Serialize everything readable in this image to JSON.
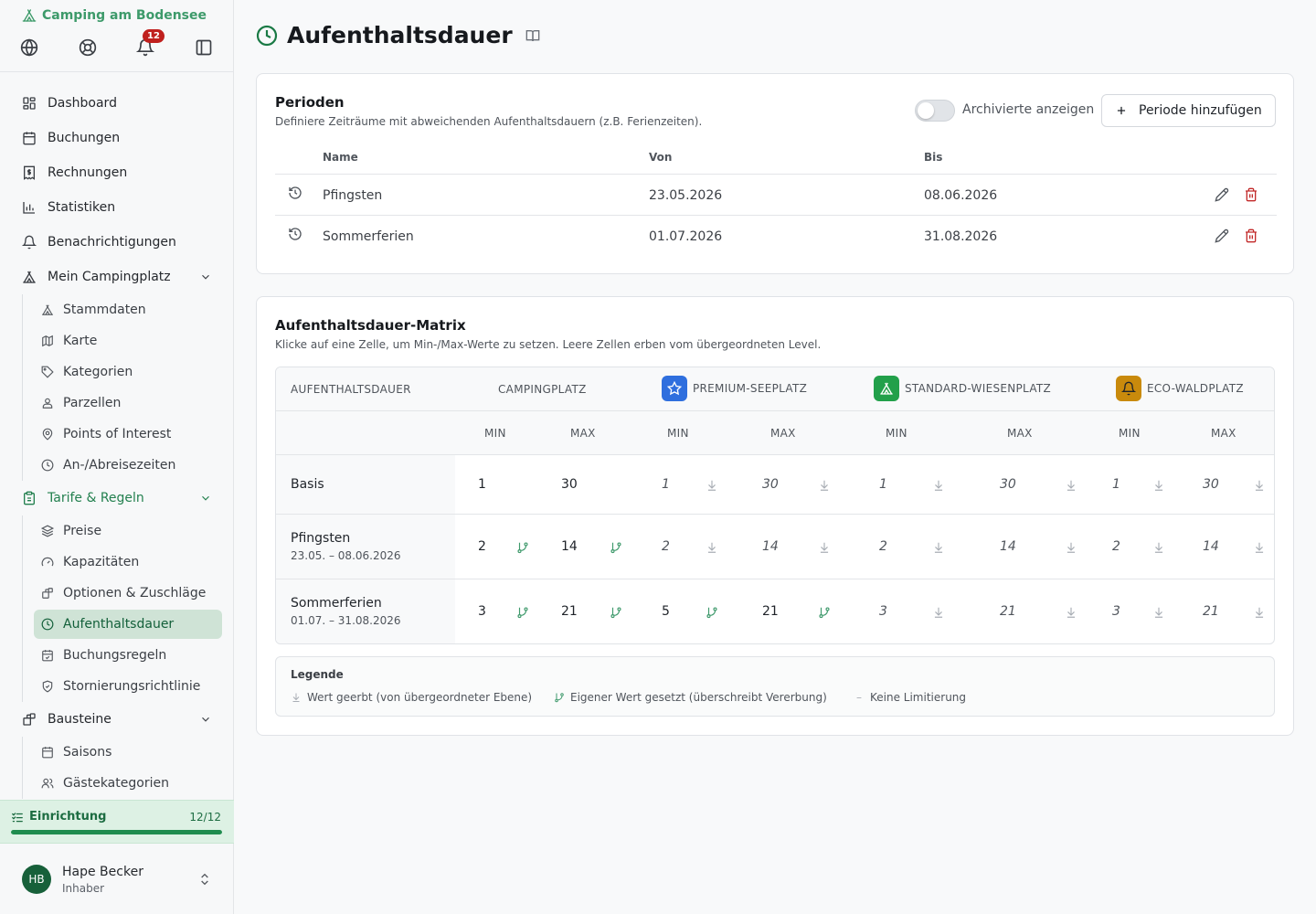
{
  "sidebar": {
    "brand": "Camping am Bodensee",
    "notification_count": "12",
    "nav": {
      "dashboard": "Dashboard",
      "buchungen": "Buchungen",
      "rechnungen": "Rechnungen",
      "statistiken": "Statistiken",
      "benachrichtigungen": "Benachrichtigungen",
      "mein_campingplatz": "Mein Campingplatz",
      "stammdaten": "Stammdaten",
      "karte": "Karte",
      "kategorien": "Kategorien",
      "parzellen": "Parzellen",
      "poi": "Points of Interest",
      "anabreise": "An-/Abreisezeiten",
      "tarife": "Tarife & Regeln",
      "preise": "Preise",
      "kapazitaeten": "Kapazitäten",
      "optionen": "Optionen & Zuschläge",
      "aufenthaltsdauer": "Aufenthaltsdauer",
      "buchungsregeln": "Buchungsregeln",
      "storno": "Stornierungsrichtlinie",
      "bausteine": "Bausteine",
      "saisons": "Saisons",
      "gaestekategorien": "Gästekategorien"
    },
    "setup": {
      "label": "Einrichtung",
      "count": "12/12",
      "progress": 1.0
    },
    "user": {
      "initials": "HB",
      "name": "Hape Becker",
      "role": "Inhaber"
    }
  },
  "page": {
    "title": "Aufenthaltsdauer"
  },
  "periods": {
    "title": "Perioden",
    "description": "Definiere Zeiträume mit abweichenden Aufenthaltsdauern (z.B. Ferienzeiten).",
    "toggle_label": "Archivierte anzeigen",
    "add_button": "Periode hinzufügen",
    "columns": {
      "name": "Name",
      "from": "Von",
      "to": "Bis"
    },
    "rows": [
      {
        "name": "Pfingsten",
        "from": "23.05.2026",
        "to": "08.06.2026"
      },
      {
        "name": "Sommerferien",
        "from": "01.07.2026",
        "to": "31.08.2026"
      }
    ]
  },
  "matrix": {
    "title": "Aufenthaltsdauer-Matrix",
    "description": "Klicke auf eine Zelle, um Min-/Max-Werte zu setzen. Leere Zellen erben vom übergeordneten Level.",
    "corner": "AUFENTHALTSDAUER",
    "levels": [
      {
        "name": "CAMPINGPLATZ"
      },
      {
        "name": "PREMIUM-SEEPLATZ",
        "icon": "star-icon",
        "color": "#2f6fde"
      },
      {
        "name": "STANDARD-WIESENPLATZ",
        "icon": "tent-icon",
        "color": "#22a04a"
      },
      {
        "name": "ECO-WALDPLATZ",
        "icon": "bell-icon",
        "color": "#c98a0c"
      }
    ],
    "min_label": "MIN",
    "max_label": "MAX",
    "rows": [
      {
        "name": "Basis",
        "range": "",
        "cells": [
          {
            "v": "1",
            "s": "own"
          },
          {
            "v": "30",
            "s": "own"
          },
          {
            "v": "1",
            "s": "inh"
          },
          {
            "v": "30",
            "s": "inh"
          },
          {
            "v": "1",
            "s": "inh"
          },
          {
            "v": "30",
            "s": "inh"
          },
          {
            "v": "1",
            "s": "inh"
          },
          {
            "v": "30",
            "s": "inh"
          }
        ]
      },
      {
        "name": "Pfingsten",
        "range": "23.05. – 08.06.2026",
        "cells": [
          {
            "v": "2",
            "s": "set"
          },
          {
            "v": "14",
            "s": "set"
          },
          {
            "v": "2",
            "s": "inh"
          },
          {
            "v": "14",
            "s": "inh"
          },
          {
            "v": "2",
            "s": "inh"
          },
          {
            "v": "14",
            "s": "inh"
          },
          {
            "v": "2",
            "s": "inh"
          },
          {
            "v": "14",
            "s": "inh"
          }
        ]
      },
      {
        "name": "Sommerferien",
        "range": "01.07. – 31.08.2026",
        "cells": [
          {
            "v": "3",
            "s": "set"
          },
          {
            "v": "21",
            "s": "set"
          },
          {
            "v": "5",
            "s": "set"
          },
          {
            "v": "21",
            "s": "set"
          },
          {
            "v": "3",
            "s": "inh"
          },
          {
            "v": "21",
            "s": "inh"
          },
          {
            "v": "3",
            "s": "inh"
          },
          {
            "v": "21",
            "s": "inh"
          }
        ]
      }
    ]
  },
  "legend": {
    "title": "Legende",
    "inherited": "Wert geerbt (von übergeordneter Ebene)",
    "own": "Eigener Wert gesetzt (überschreibt Vererbung)",
    "none_symbol": "–",
    "none": "Keine Limitierung"
  }
}
